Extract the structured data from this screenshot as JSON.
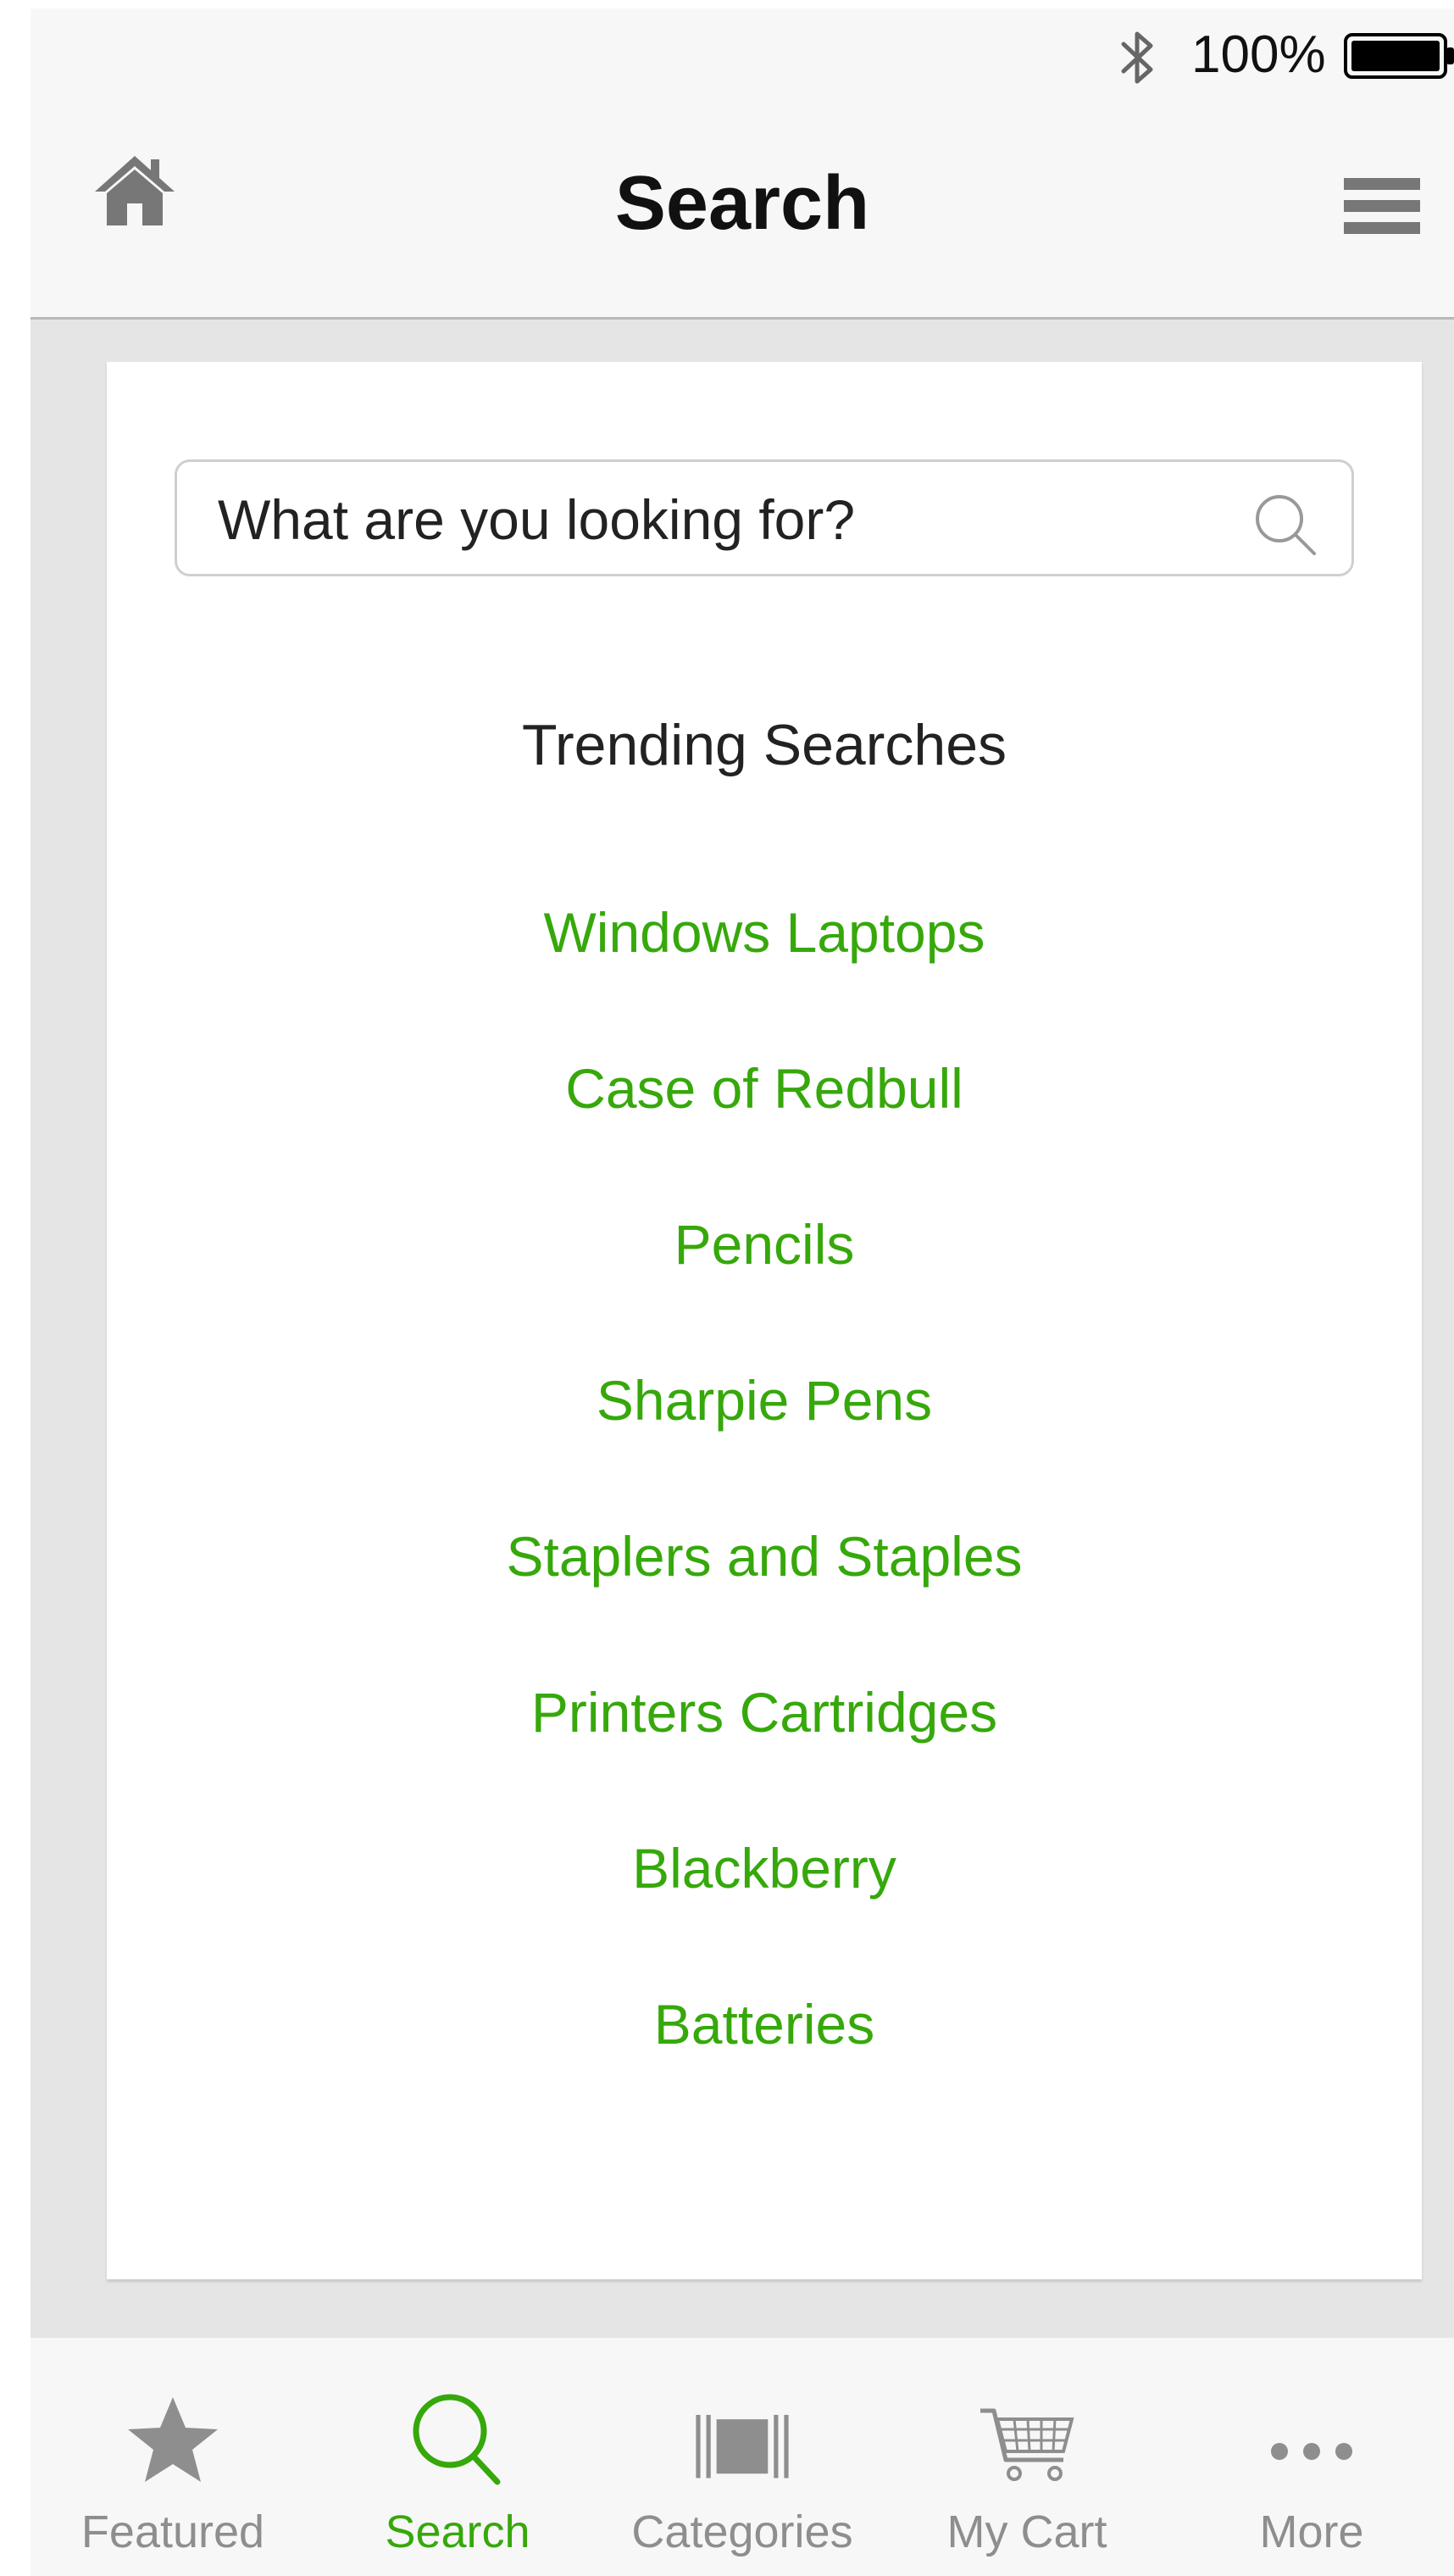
{
  "status_bar": {
    "battery_percent": "100%",
    "bluetooth_icon": "bluetooth-icon",
    "battery_icon": "battery-full-icon"
  },
  "nav": {
    "title": "Search",
    "home_icon": "home-icon",
    "menu_icon": "hamburger-menu-icon"
  },
  "search": {
    "placeholder": "What are you looking for?",
    "value": "",
    "icon": "magnifier-icon"
  },
  "trending": {
    "title": "Trending Searches",
    "items": [
      "Windows Laptops",
      "Case of Redbull",
      "Pencils",
      "Sharpie Pens",
      "Staplers and Staples",
      "Printers Cartridges",
      "Blackberry",
      "Batteries"
    ]
  },
  "tabs": [
    {
      "label": "Featured",
      "icon": "star-icon",
      "active": false
    },
    {
      "label": "Search",
      "icon": "magnifier-icon",
      "active": true
    },
    {
      "label": "Categories",
      "icon": "barcode-icon",
      "active": false
    },
    {
      "label": "My Cart",
      "icon": "cart-icon",
      "active": false
    },
    {
      "label": "More",
      "icon": "ellipsis-icon",
      "active": false
    }
  ],
  "colors": {
    "accent": "#36a80b",
    "inactive": "#8e8e8e",
    "bar_background": "#f7f7f7",
    "page_background": "#e5e5e5"
  }
}
